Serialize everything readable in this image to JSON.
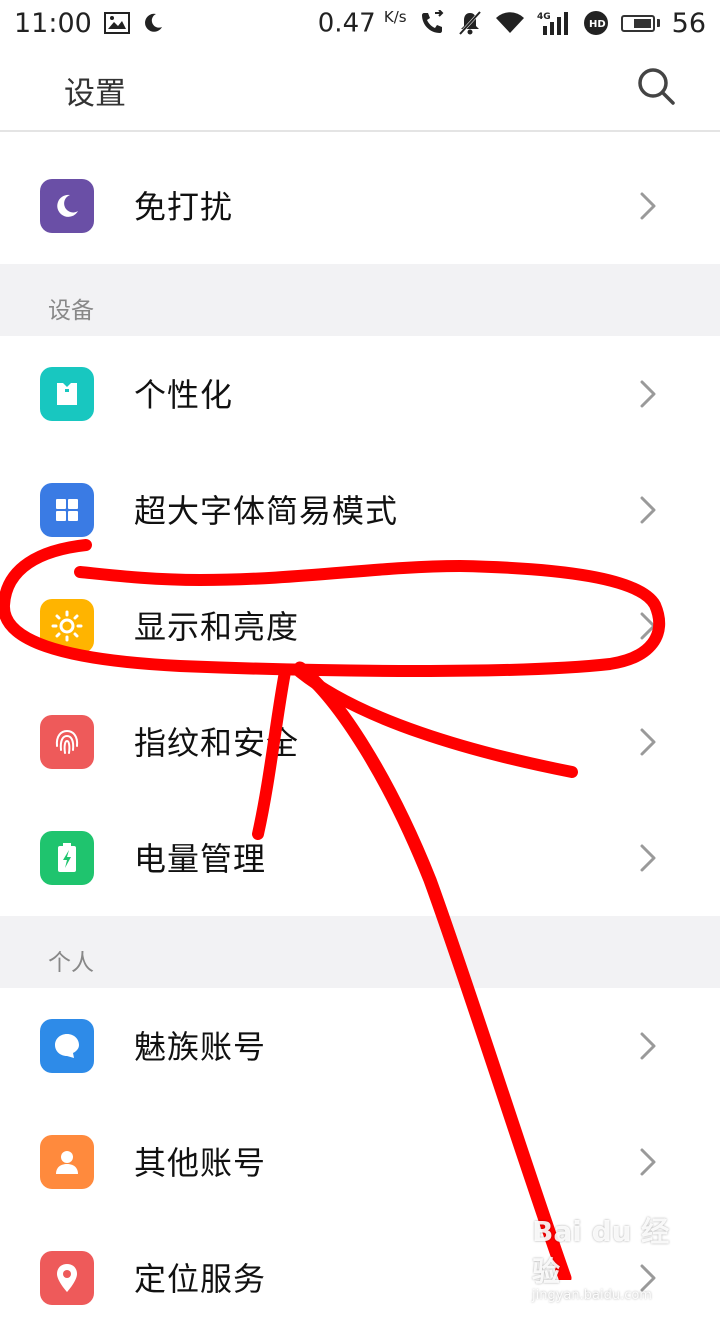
{
  "status_bar": {
    "time": "11:00",
    "speed": "0.47",
    "speed_unit": "K/s",
    "network": "4G",
    "battery": "56"
  },
  "header": {
    "title": "设置",
    "search_icon": "search-icon"
  },
  "rows": {
    "dnd": {
      "label": "免打扰",
      "icon": "moon-icon",
      "color": "#6a4fa6"
    },
    "personalize": {
      "label": "个性化",
      "icon": "shirt-icon",
      "color": "#18c7c0"
    },
    "large_font": {
      "label": "超大字体简易模式",
      "icon": "grid-icon",
      "color": "#3a7be4"
    },
    "display": {
      "label": "显示和亮度",
      "icon": "sun-icon",
      "color": "#ffb400"
    },
    "fingerprint": {
      "label": "指纹和安全",
      "icon": "fingerprint-icon",
      "color": "#ee5a5a"
    },
    "battery": {
      "label": "电量管理",
      "icon": "battery-bolt-icon",
      "color": "#1fc46e"
    },
    "meizu_account": {
      "label": "魅族账号",
      "icon": "chat-bubble-icon",
      "color": "#2e8be8"
    },
    "other_accounts": {
      "label": "其他账号",
      "icon": "person-icon",
      "color": "#ff8a3d"
    },
    "location": {
      "label": "定位服务",
      "icon": "location-pin-icon",
      "color": "#ee5a5a"
    }
  },
  "sections": {
    "device": "设备",
    "personal": "个人"
  },
  "watermark": {
    "main": "Bai du 经验",
    "sub": "jingyan.baidu.com"
  },
  "colors": {
    "annotation": "#ff0000",
    "divider": "#e4e4e4",
    "section_bg": "#f2f2f4"
  }
}
